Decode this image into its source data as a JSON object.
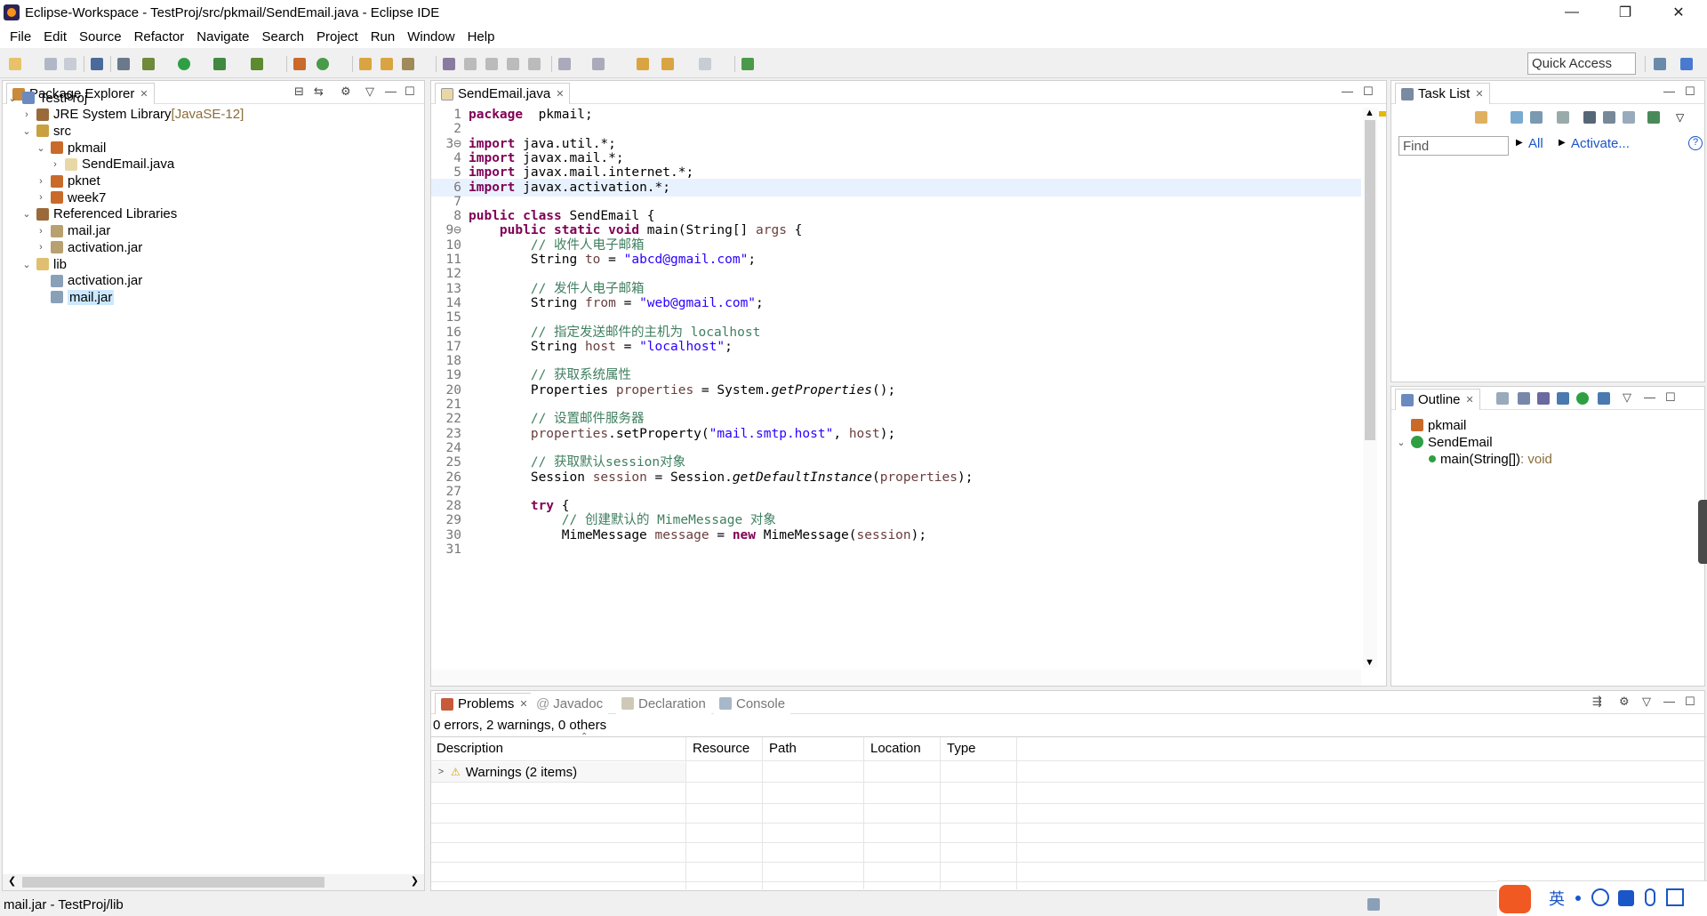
{
  "window": {
    "title": "Eclipse-Workspace - TestProj/src/pkmail/SendEmail.java - Eclipse IDE",
    "minimize": "—",
    "restore": "❐",
    "close": "✕"
  },
  "menu": [
    "File",
    "Edit",
    "Source",
    "Refactor",
    "Navigate",
    "Search",
    "Project",
    "Run",
    "Window",
    "Help"
  ],
  "toolbar": {
    "quick_access_placeholder": "Quick Access"
  },
  "package_explorer": {
    "tab": "Package Explorer",
    "items": [
      {
        "label": "TestProj",
        "depth": 0,
        "chev": "v",
        "icon": "project-icon"
      },
      {
        "label": "JRE System Library",
        "suffix": "[JavaSE-12]",
        "depth": 1,
        "chev": ">",
        "icon": "library-icon"
      },
      {
        "label": "src",
        "depth": 1,
        "chev": "v",
        "icon": "source-folder-icon"
      },
      {
        "label": "pkmail",
        "depth": 2,
        "chev": "v",
        "icon": "package-icon"
      },
      {
        "label": "SendEmail.java",
        "depth": 3,
        "chev": ">",
        "icon": "java-file-icon"
      },
      {
        "label": "pknet",
        "depth": 2,
        "chev": ">",
        "icon": "package-icon"
      },
      {
        "label": "week7",
        "depth": 2,
        "chev": ">",
        "icon": "package-icon"
      },
      {
        "label": "Referenced Libraries",
        "depth": 1,
        "chev": "v",
        "icon": "library-icon"
      },
      {
        "label": "mail.jar",
        "depth": 2,
        "chev": ">",
        "icon": "jar-icon"
      },
      {
        "label": "activation.jar",
        "depth": 2,
        "chev": ">",
        "icon": "jar-icon"
      },
      {
        "label": "lib",
        "depth": 1,
        "chev": "v",
        "icon": "folder-icon"
      },
      {
        "label": "activation.jar",
        "depth": 2,
        "chev": "",
        "icon": "jar-file-icon"
      },
      {
        "label": "mail.jar",
        "depth": 2,
        "chev": "",
        "icon": "jar-file-icon",
        "selected": true
      }
    ]
  },
  "editor": {
    "tab": "SendEmail.java",
    "lines": [
      {
        "n": "1",
        "t": [
          [
            "kw",
            "package"
          ],
          [
            "",
            "  pkmail;"
          ]
        ]
      },
      {
        "n": "2",
        "t": []
      },
      {
        "n": "3⊖",
        "t": [
          [
            "kw",
            "import"
          ],
          [
            "",
            " java.util.*;"
          ]
        ]
      },
      {
        "n": "4",
        "t": [
          [
            "kw",
            "import"
          ],
          [
            "",
            " javax.mail.*;"
          ]
        ]
      },
      {
        "n": "5",
        "t": [
          [
            "kw",
            "import"
          ],
          [
            "",
            " javax.mail.internet.*;"
          ]
        ]
      },
      {
        "n": "6",
        "t": [
          [
            "kw",
            "import"
          ],
          [
            "",
            " javax.activation.*;"
          ]
        ],
        "hl": true
      },
      {
        "n": "7",
        "t": []
      },
      {
        "n": "8",
        "t": [
          [
            "kw",
            "public class"
          ],
          [
            "",
            " SendEmail {"
          ]
        ]
      },
      {
        "n": "9⊖",
        "t": [
          [
            "",
            "    "
          ],
          [
            "kw",
            "public static void"
          ],
          [
            "",
            " main(String[] "
          ],
          [
            "var",
            "args"
          ],
          [
            "",
            " {"
          ]
        ]
      },
      {
        "n": "10",
        "t": [
          [
            "cm",
            "        // 收件人电子邮箱"
          ]
        ]
      },
      {
        "n": "11",
        "t": [
          [
            "",
            "        String "
          ],
          [
            "var",
            "to"
          ],
          [
            "",
            " = "
          ],
          [
            "str",
            "\"abcd@gmail.com\""
          ],
          [
            "",
            ";"
          ]
        ]
      },
      {
        "n": "12",
        "t": []
      },
      {
        "n": "13",
        "t": [
          [
            "cm",
            "        // 发件人电子邮箱"
          ]
        ]
      },
      {
        "n": "14",
        "t": [
          [
            "",
            "        String "
          ],
          [
            "var",
            "from"
          ],
          [
            "",
            " = "
          ],
          [
            "str",
            "\"web@gmail.com\""
          ],
          [
            "",
            ";"
          ]
        ]
      },
      {
        "n": "15",
        "t": []
      },
      {
        "n": "16",
        "t": [
          [
            "cm",
            "        // 指定发送邮件的主机为 localhost"
          ]
        ]
      },
      {
        "n": "17",
        "t": [
          [
            "",
            "        String "
          ],
          [
            "var",
            "host"
          ],
          [
            "",
            " = "
          ],
          [
            "str",
            "\"localhost\""
          ],
          [
            "",
            ";"
          ]
        ]
      },
      {
        "n": "18",
        "t": []
      },
      {
        "n": "19",
        "t": [
          [
            "cm",
            "        // 获取系统属性"
          ]
        ]
      },
      {
        "n": "20",
        "t": [
          [
            "",
            "        Properties "
          ],
          [
            "var",
            "properties"
          ],
          [
            "",
            " = System."
          ],
          [
            "it",
            "getProperties"
          ],
          [
            "",
            "();"
          ]
        ]
      },
      {
        "n": "21",
        "t": []
      },
      {
        "n": "22",
        "t": [
          [
            "cm",
            "        // 设置邮件服务器"
          ]
        ]
      },
      {
        "n": "23",
        "t": [
          [
            "",
            "        "
          ],
          [
            "var",
            "properties"
          ],
          [
            "",
            ".setProperty("
          ],
          [
            "str",
            "\"mail.smtp.host\""
          ],
          [
            "",
            ", "
          ],
          [
            "var",
            "host"
          ],
          [
            "",
            ");"
          ]
        ]
      },
      {
        "n": "24",
        "t": []
      },
      {
        "n": "25",
        "t": [
          [
            "cm",
            "        // 获取默认session对象"
          ]
        ]
      },
      {
        "n": "26",
        "t": [
          [
            "",
            "        Session "
          ],
          [
            "var",
            "session"
          ],
          [
            "",
            " = Session."
          ],
          [
            "it",
            "getDefaultInstance"
          ],
          [
            "",
            "("
          ],
          [
            "var",
            "properties"
          ],
          [
            "",
            ");"
          ]
        ]
      },
      {
        "n": "27",
        "t": []
      },
      {
        "n": "28",
        "t": [
          [
            "",
            "        "
          ],
          [
            "kw",
            "try"
          ],
          [
            "",
            " {"
          ]
        ]
      },
      {
        "n": "29",
        "t": [
          [
            "cm",
            "            // 创建默认的 MimeMessage 对象"
          ]
        ]
      },
      {
        "n": "30",
        "t": [
          [
            "",
            "            MimeMessage "
          ],
          [
            "var",
            "message"
          ],
          [
            "",
            " = "
          ],
          [
            "kw",
            "new"
          ],
          [
            "",
            " MimeMessage("
          ],
          [
            "var",
            "session"
          ],
          [
            "",
            ");"
          ]
        ]
      },
      {
        "n": "31",
        "t": []
      }
    ]
  },
  "task_list": {
    "tab": "Task List",
    "find_placeholder": "Find",
    "all": "All",
    "activate": "Activate...",
    "help": "?"
  },
  "outline": {
    "tab": "Outline",
    "items": [
      {
        "label": "pkmail",
        "depth": 0,
        "icon": "package-icon"
      },
      {
        "label": "SendEmail",
        "depth": 0,
        "chev": "v",
        "icon": "class-icon"
      },
      {
        "label": "main(String[])",
        "suffix": " : void",
        "depth": 1,
        "icon": "method-icon"
      }
    ]
  },
  "bottom": {
    "tabs": [
      "Problems",
      "Javadoc",
      "Declaration",
      "Console"
    ],
    "summary": "0 errors, 2 warnings, 0 others",
    "columns": [
      "Description",
      "Resource",
      "Path",
      "Location",
      "Type"
    ],
    "row": "Warnings (2 items)"
  },
  "status": {
    "text": "mail.jar - TestProj/lib"
  },
  "ime": {
    "label": "英"
  }
}
